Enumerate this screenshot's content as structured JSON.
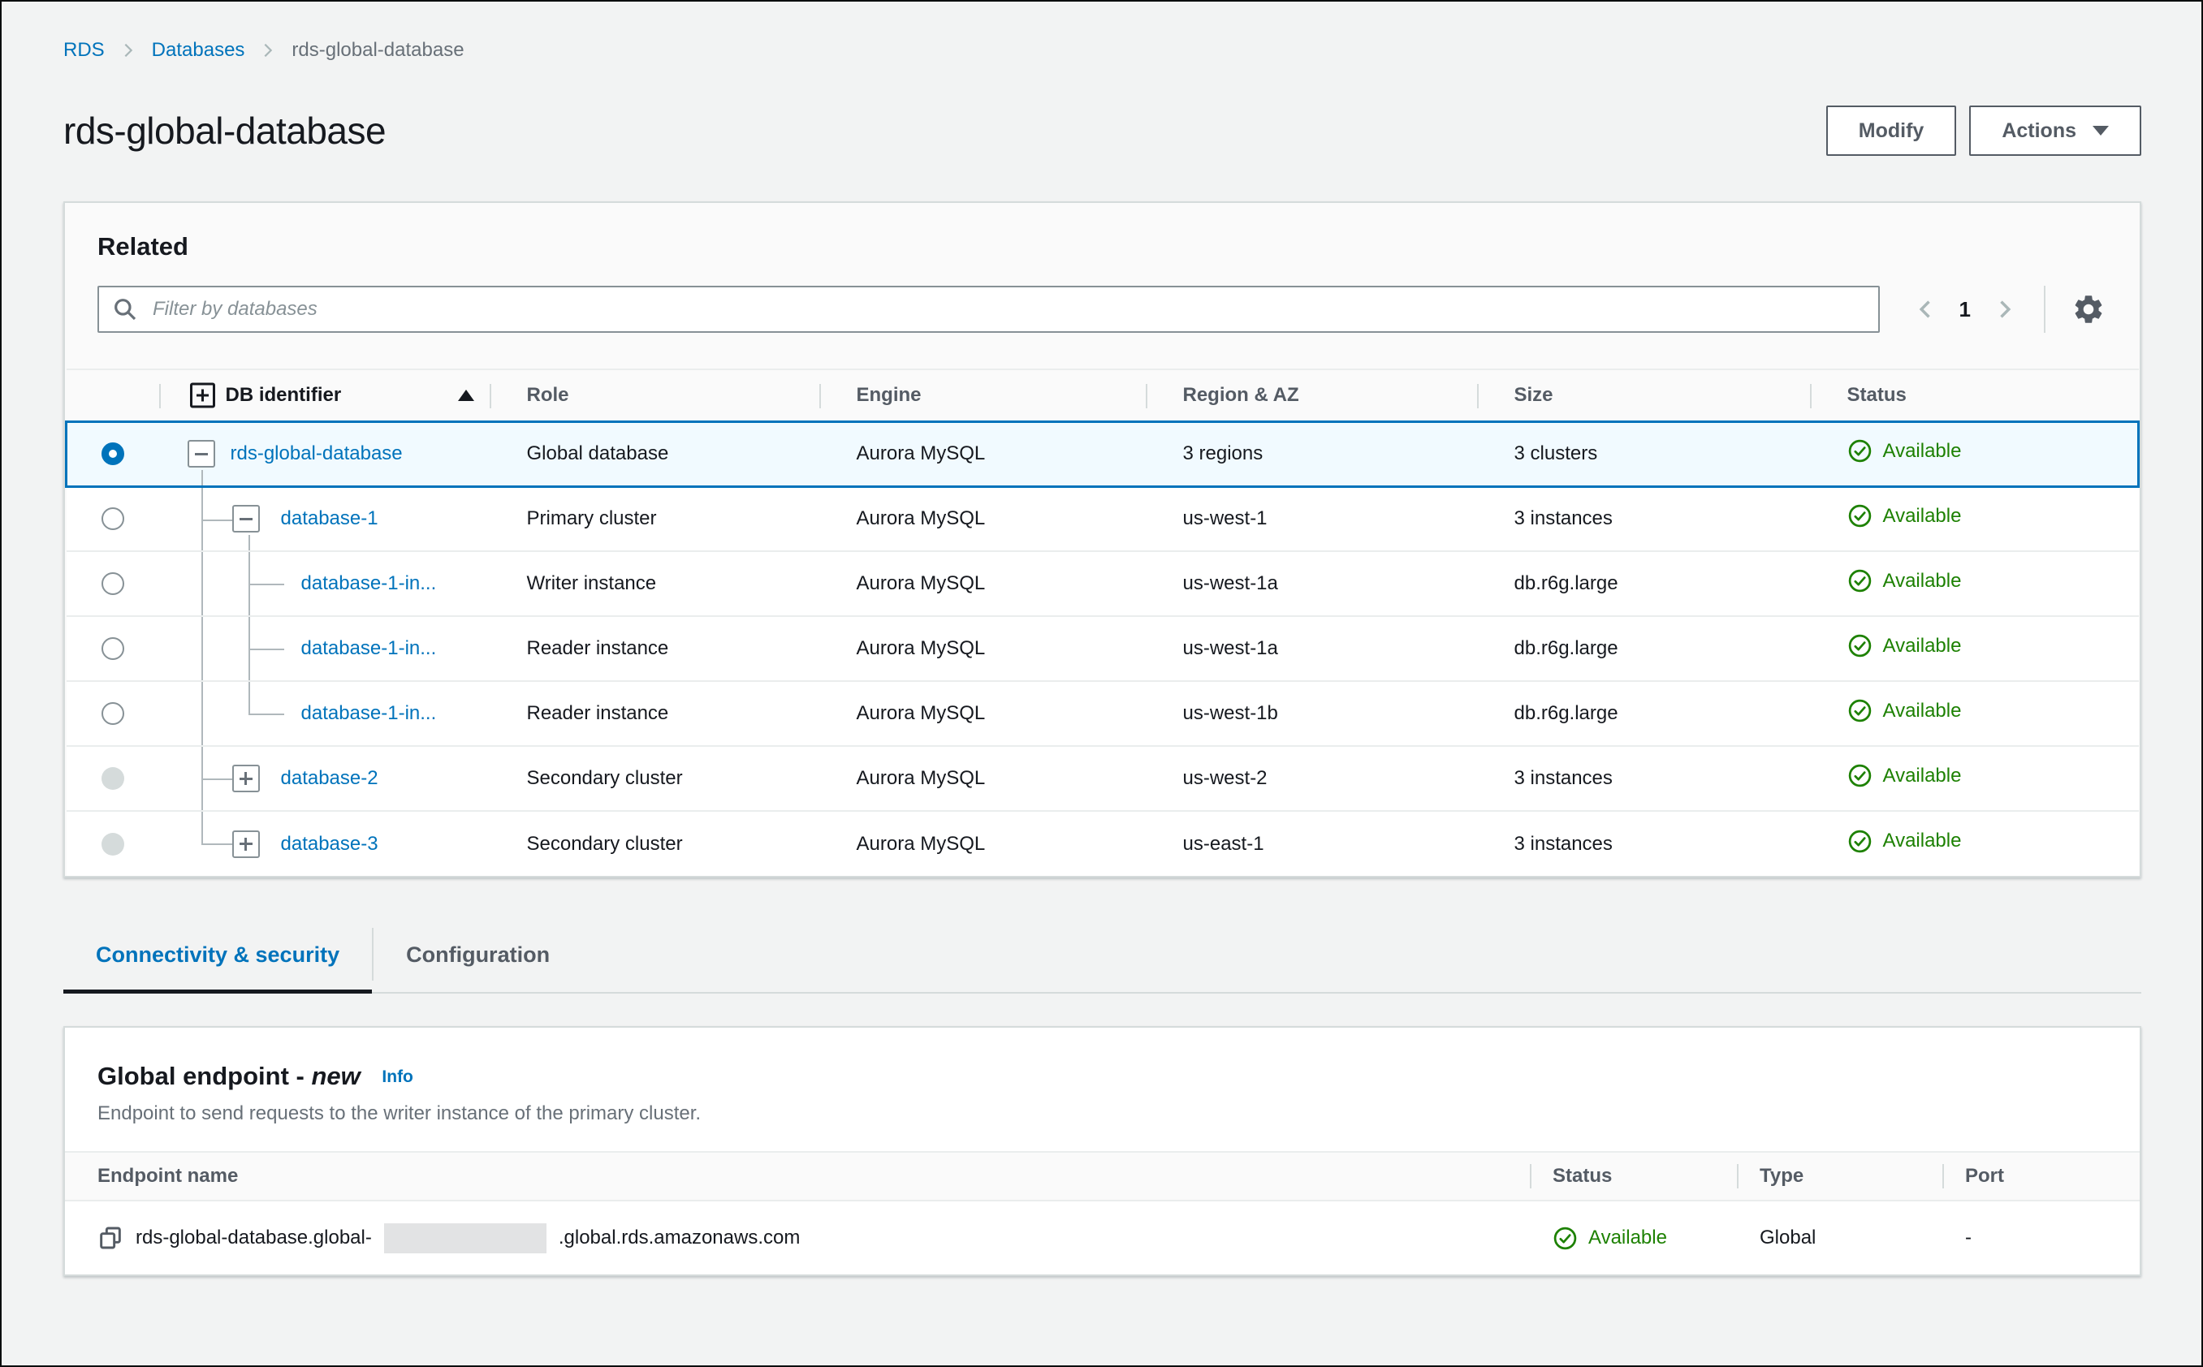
{
  "breadcrumb": {
    "items": [
      {
        "label": "RDS",
        "link": true
      },
      {
        "label": "Databases",
        "link": true
      },
      {
        "label": "rds-global-database",
        "link": false
      }
    ]
  },
  "header": {
    "title": "rds-global-database",
    "buttons": {
      "modify": "Modify",
      "actions": "Actions"
    }
  },
  "related_panel": {
    "title": "Related",
    "filter": {
      "placeholder": "Filter by databases"
    },
    "pagination": {
      "current_page": "1"
    },
    "table": {
      "columns": [
        "DB identifier",
        "Role",
        "Engine",
        "Region & AZ",
        "Size",
        "Status"
      ],
      "sort": {
        "column": "DB identifier",
        "direction": "ascending"
      },
      "rows": [
        {
          "id": "rds-global-database",
          "role": "Global database",
          "engine": "Aurora MySQL",
          "region_az": "3 regions",
          "size": "3 clusters",
          "status": "Available",
          "level": 0,
          "toggle": "minus",
          "radio": "selected",
          "selected": true,
          "last": false
        },
        {
          "id": "database-1",
          "role": "Primary cluster",
          "engine": "Aurora MySQL",
          "region_az": "us-west-1",
          "size": "3 instances",
          "status": "Available",
          "level": 1,
          "toggle": "minus",
          "radio": "unselected",
          "selected": false,
          "last": false
        },
        {
          "id": "database-1-in...",
          "role": "Writer instance",
          "engine": "Aurora MySQL",
          "region_az": "us-west-1a",
          "size": "db.r6g.large",
          "status": "Available",
          "level": 2,
          "toggle": null,
          "radio": "unselected",
          "selected": false,
          "last": false
        },
        {
          "id": "database-1-in...",
          "role": "Reader instance",
          "engine": "Aurora MySQL",
          "region_az": "us-west-1a",
          "size": "db.r6g.large",
          "status": "Available",
          "level": 2,
          "toggle": null,
          "radio": "unselected",
          "selected": false,
          "last": false
        },
        {
          "id": "database-1-in...",
          "role": "Reader instance",
          "engine": "Aurora MySQL",
          "region_az": "us-west-1b",
          "size": "db.r6g.large",
          "status": "Available",
          "level": 2,
          "toggle": null,
          "radio": "unselected",
          "selected": false,
          "last": true
        },
        {
          "id": "database-2",
          "role": "Secondary cluster",
          "engine": "Aurora MySQL",
          "region_az": "us-west-2",
          "size": "3 instances",
          "status": "Available",
          "level": 1,
          "toggle": "plus",
          "radio": "disabled",
          "selected": false,
          "last": false
        },
        {
          "id": "database-3",
          "role": "Secondary cluster",
          "engine": "Aurora MySQL",
          "region_az": "us-east-1",
          "size": "3 instances",
          "status": "Available",
          "level": 1,
          "toggle": "plus",
          "radio": "disabled",
          "selected": false,
          "last": true
        }
      ]
    }
  },
  "tabs": [
    {
      "label": "Connectivity & security",
      "active": true
    },
    {
      "label": "Configuration",
      "active": false
    }
  ],
  "endpoint_panel": {
    "title_prefix": "Global endpoint - ",
    "title_emphasis": "new",
    "info_label": "Info",
    "description": "Endpoint to send requests to the writer instance of the primary cluster.",
    "table": {
      "columns": [
        "Endpoint name",
        "Status",
        "Type",
        "Port"
      ],
      "rows": [
        {
          "name_prefix": "rds-global-database.global-",
          "name_redacted": true,
          "name_suffix": ".global.rds.amazonaws.com",
          "status": "Available",
          "type": "Global",
          "port": "-"
        }
      ]
    }
  },
  "icons": {
    "breadcrumb_separator": "chevron-right",
    "filter": "magnifier",
    "pagination_previous": "chevron-left",
    "pagination_next": "chevron-right",
    "preferences": "gear",
    "expand_all": "plus-square",
    "sort": "triangle-up",
    "collapse_row": "minus-square",
    "expand_row": "plus-square",
    "status_ok": "check-circle",
    "actions_menu": "triangle-down",
    "copy_endpoint": "copy-squares"
  },
  "colors": {
    "link": "#0073bb",
    "accent": "#0073bb",
    "success": "#1d8102",
    "selected_row_bg": "#f1faff",
    "page_bg": "#f2f3f3",
    "card_bg": "#fafafa",
    "border": "#d5dbdb",
    "text_dark": "#16191f",
    "text_gray": "#545b64",
    "text_muted": "#687078",
    "disabled": "#aab7b8"
  }
}
